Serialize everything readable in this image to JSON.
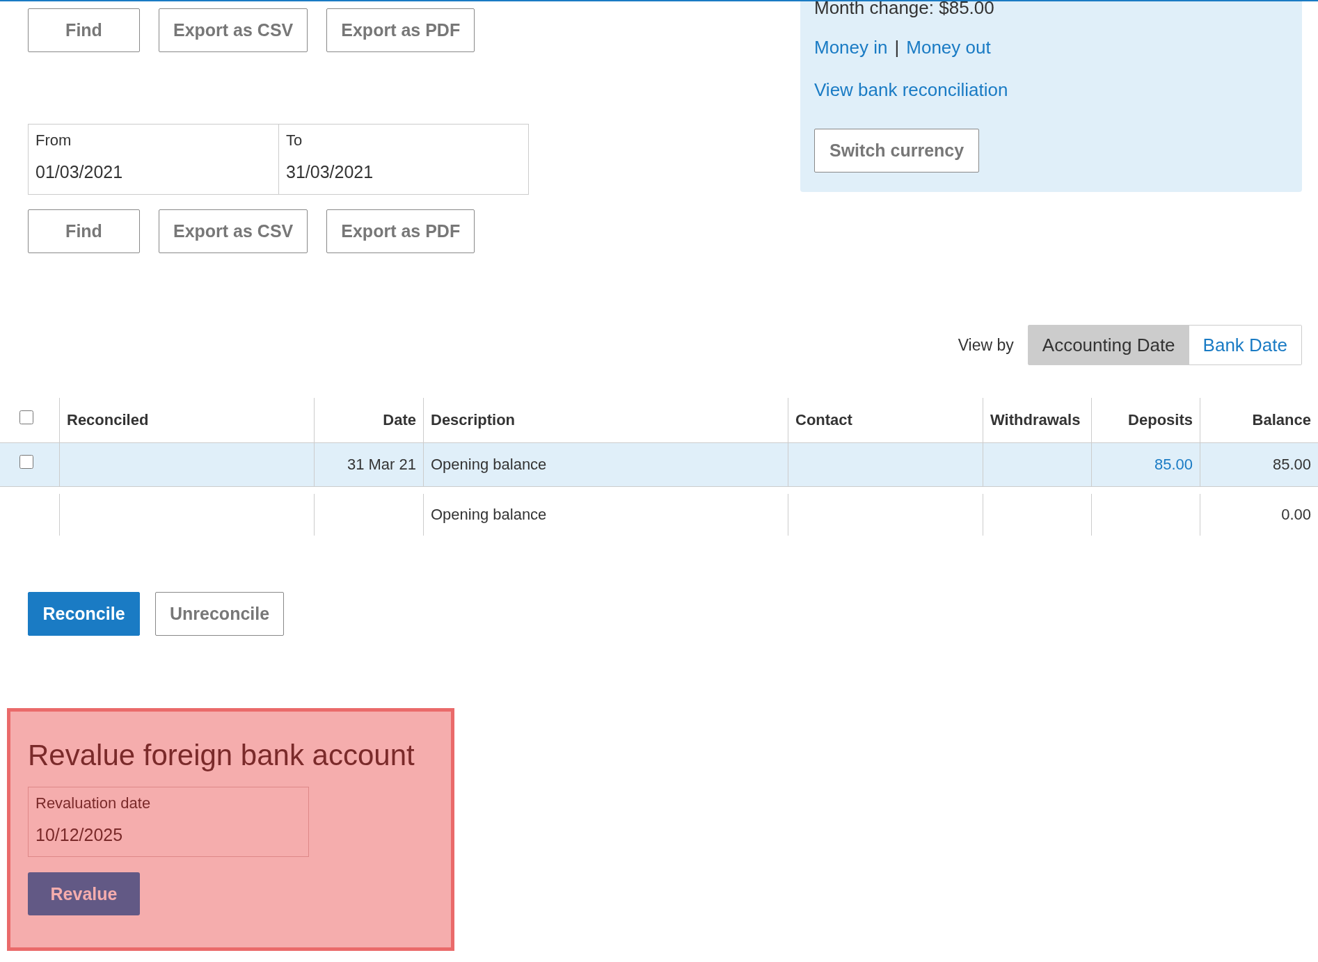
{
  "toolbar_top": {
    "buttons": [
      "Find",
      "Export as CSV",
      "Export as PDF"
    ]
  },
  "date_range": {
    "fields": [
      {
        "label": "From",
        "value": "01/03/2021"
      },
      {
        "label": "To",
        "value": "31/03/2021"
      }
    ]
  },
  "toolbar_bottom": {
    "buttons": [
      "Find",
      "Export as CSV",
      "Export as PDF"
    ]
  },
  "account_panel": {
    "month_change": "Month change: $85.00",
    "links": [
      "Money in",
      "Money out"
    ],
    "separator": "|",
    "reconciliation_link": "View bank reconciliation",
    "button": "Switch currency"
  },
  "view_by": {
    "label": "View by",
    "options": [
      {
        "label": "Accounting Date",
        "selected": true
      },
      {
        "label": "Bank Date",
        "selected": false
      }
    ]
  },
  "table": {
    "select_all_checked": false,
    "columns": [
      "Reconciled",
      "Date",
      "Description",
      "Contact",
      "Withdrawals",
      "Deposits",
      "Balance"
    ],
    "rows": [
      {
        "kind": "transaction",
        "checked": false,
        "date": "31 Mar 21",
        "description": "Opening balance",
        "deposits": "85.00",
        "balance": "85.00"
      },
      {
        "kind": "summary",
        "description": "Opening balance",
        "balance": "0.00"
      }
    ]
  },
  "actions": [
    {
      "label": "Reconcile",
      "kind": "primary"
    },
    {
      "label": "Unreconcile",
      "kind": "secondary"
    }
  ],
  "revalue_panel": {
    "title": "Revalue foreign bank account",
    "field": {
      "label": "Revaluation date",
      "value": "10/12/2025"
    },
    "button": "Revalue"
  }
}
